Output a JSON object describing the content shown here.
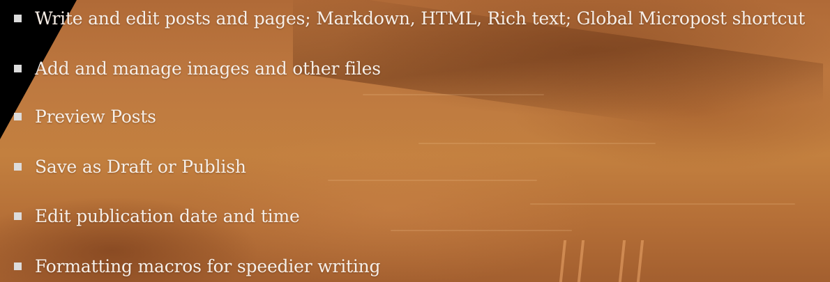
{
  "features": {
    "items": [
      {
        "label": "Write and edit posts and pages; Markdown, HTML, Rich text; Global Micropost shortcut"
      },
      {
        "label": "Add and manage images and other files"
      },
      {
        "label": "Preview Posts"
      },
      {
        "label": "Save as Draft or Publish"
      },
      {
        "label": "Edit publication date and time"
      },
      {
        "label": "Formatting macros for speedier writing"
      }
    ]
  }
}
